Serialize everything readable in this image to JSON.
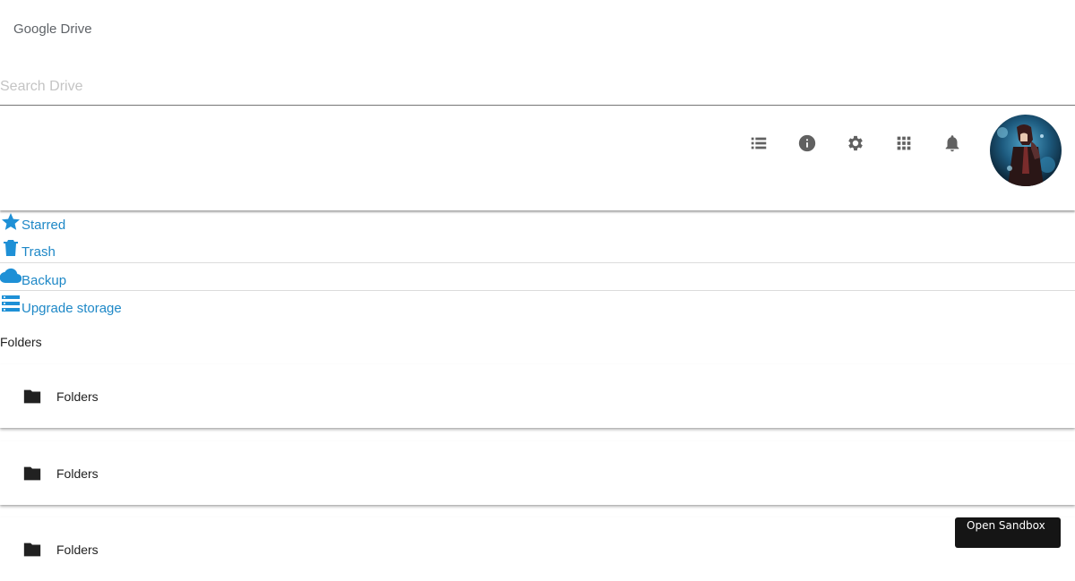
{
  "app": {
    "title": "Google Drive"
  },
  "search": {
    "placeholder": "Search Drive",
    "value": ""
  },
  "toolbar": {
    "icons": [
      "list-view-icon",
      "info-icon",
      "settings-icon",
      "apps-grid-icon",
      "notifications-bell-icon"
    ]
  },
  "avatar": {
    "icon": "user-avatar"
  },
  "nav": {
    "items": [
      {
        "label": "Starred",
        "icon": "star-icon"
      },
      {
        "label": "Trash",
        "icon": "trash-icon"
      },
      {
        "label": "Backup",
        "icon": "cloud-icon"
      },
      {
        "label": "Upgrade storage",
        "icon": "storage-icon"
      }
    ]
  },
  "folders": {
    "section_title": "Folders",
    "items": [
      {
        "label": "Folders",
        "icon": "folder-icon"
      },
      {
        "label": "Folders",
        "icon": "folder-icon"
      },
      {
        "label": "Folders",
        "icon": "folder-icon"
      }
    ]
  },
  "sandbox": {
    "label": "Open Sandbox"
  },
  "colors": {
    "link": "#1e88c7",
    "nav_icon": "#1e90d6",
    "toolbar_icon": "#616161",
    "sandbox_bg": "#151515"
  }
}
